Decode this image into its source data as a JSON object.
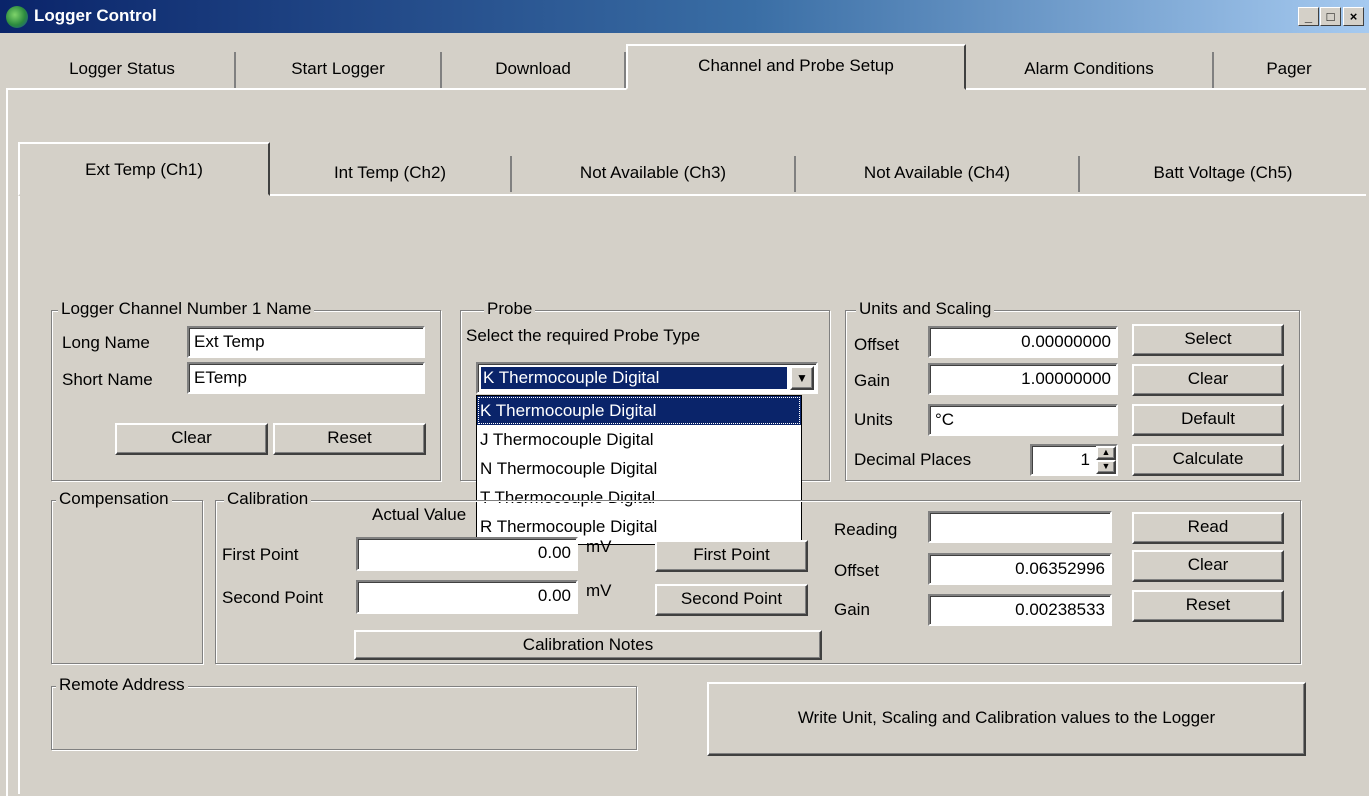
{
  "window": {
    "title": "Logger Control",
    "min": "_",
    "max": "□",
    "close": "×"
  },
  "main_tabs": [
    {
      "label": "Logger Status"
    },
    {
      "label": "Start Logger"
    },
    {
      "label": "Download"
    },
    {
      "label": "Channel and Probe Setup"
    },
    {
      "label": "Alarm Conditions"
    },
    {
      "label": "Pager"
    }
  ],
  "channel_tabs": [
    {
      "label": "Ext Temp (Ch1)"
    },
    {
      "label": "Int Temp (Ch2)"
    },
    {
      "label": "Not Available (Ch3)"
    },
    {
      "label": "Not Available (Ch4)"
    },
    {
      "label": "Batt Voltage (Ch5)"
    }
  ],
  "channel_name": {
    "legend": "Logger Channel Number 1 Name",
    "long_label": "Long Name",
    "long_value": "Ext Temp",
    "short_label": "Short Name",
    "short_value": "ETemp",
    "clear": "Clear",
    "reset": "Reset"
  },
  "probe": {
    "legend": "Probe",
    "prompt": "Select the required Probe Type",
    "selected": "K Thermocouple Digital",
    "options": [
      "K Thermocouple Digital",
      "J Thermocouple Digital",
      "N Thermocouple Digital",
      "T Thermocouple Digital",
      "R Thermocouple Digital"
    ]
  },
  "units": {
    "legend": "Units and Scaling",
    "offset_label": "Offset",
    "offset_value": "0.00000000",
    "gain_label": "Gain",
    "gain_value": "1.00000000",
    "units_label": "Units",
    "units_value": "°C",
    "decimal_label": "Decimal Places",
    "decimal_value": "1",
    "select": "Select",
    "clear": "Clear",
    "default": "Default",
    "calculate": "Calculate"
  },
  "compensation": {
    "legend": "Compensation"
  },
  "calibration": {
    "legend": "Calibration",
    "actual_value": "Actual Value",
    "first_label": "First Point",
    "first_value": "0.00",
    "first_unit": "mV",
    "first_btn": "First Point",
    "second_label": "Second Point",
    "second_value": "0.00",
    "second_unit": "mV",
    "second_btn": "Second Point",
    "notes": "Calibration Notes",
    "reading_label": "Reading",
    "reading_value": "",
    "offset_label": "Offset",
    "offset_value": "0.06352996",
    "gain_label": "Gain",
    "gain_value": "0.00238533",
    "read": "Read",
    "clear": "Clear",
    "reset": "Reset"
  },
  "remote": {
    "legend": "Remote Address"
  },
  "write_button": "Write Unit, Scaling and Calibration values to the Logger"
}
